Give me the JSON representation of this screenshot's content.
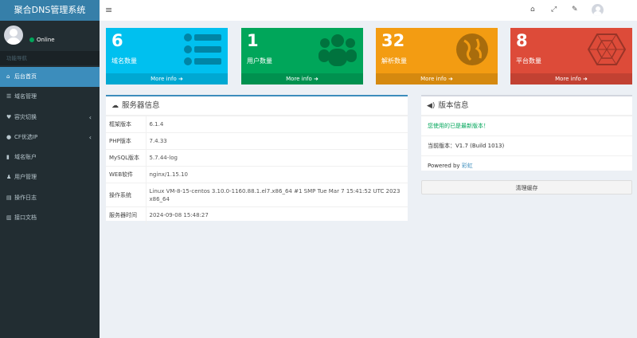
{
  "app": {
    "title": "聚合DNS管理系统"
  },
  "user": {
    "status": "Online"
  },
  "sidebar": {
    "header": "功能导航",
    "items": [
      {
        "label": "后台首页",
        "icon": "home-icon",
        "active": true,
        "chevron": false
      },
      {
        "label": "域名管理",
        "icon": "list-icon",
        "active": false,
        "chevron": false
      },
      {
        "label": "容灾切换",
        "icon": "heartbeat-icon",
        "active": false,
        "chevron": true
      },
      {
        "label": "CF优选IP",
        "icon": "cloud-icon",
        "active": false,
        "chevron": true
      },
      {
        "label": "域名账户",
        "icon": "lock-icon",
        "active": false,
        "chevron": false
      },
      {
        "label": "用户管理",
        "icon": "user-icon",
        "active": false,
        "chevron": false
      },
      {
        "label": "操作日志",
        "icon": "log-icon",
        "active": false,
        "chevron": false
      },
      {
        "label": "接口文档",
        "icon": "book-icon",
        "active": false,
        "chevron": false
      }
    ]
  },
  "header": {
    "icons": [
      "home-icon",
      "expand-icon",
      "wrench-icon",
      "avatar"
    ]
  },
  "stats": [
    {
      "value": "6",
      "label": "域名数量",
      "link": "More info",
      "color": "#00c0ef",
      "icon": "list-icon"
    },
    {
      "value": "1",
      "label": "用户数量",
      "link": "More info",
      "color": "#00a65a",
      "icon": "users-icon"
    },
    {
      "value": "32",
      "label": "解析数量",
      "link": "More info",
      "color": "#f39c12",
      "icon": "globe-icon"
    },
    {
      "value": "8",
      "label": "平台数量",
      "link": "More info",
      "color": "#dd4b39",
      "icon": "hexagon-icon"
    }
  ],
  "server": {
    "title": "服务器信息",
    "rows": [
      {
        "key": "框架版本",
        "value": "6.1.4"
      },
      {
        "key": "PHP版本",
        "value": "7.4.33"
      },
      {
        "key": "MySQL版本",
        "value": "5.7.44-log"
      },
      {
        "key": "WEB软件",
        "value": "nginx/1.15.10"
      },
      {
        "key": "操作系统",
        "value": "Linux VM-8-15-centos 3.10.0-1160.88.1.el7.x86_64 #1 SMP Tue Mar 7 15:41:52 UTC 2023 x86_64"
      },
      {
        "key": "服务器时间",
        "value": "2024-09-08 15:48:27"
      }
    ]
  },
  "version": {
    "title": "版本信息",
    "latest_msg": "您使用的已是最新版本！",
    "current_label": "当前版本：V1.7 (Build 1013)",
    "powered_prefix": "Powered by ",
    "powered_link": "彩虹"
  },
  "actions": {
    "clear_cache": "清理缓存"
  }
}
